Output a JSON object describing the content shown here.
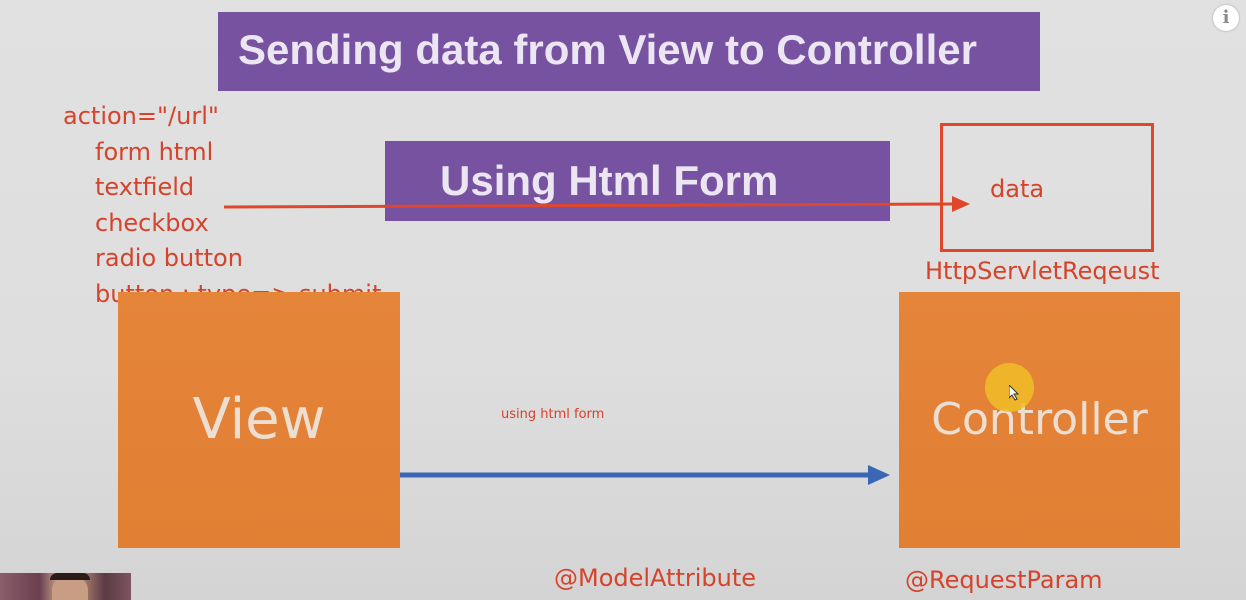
{
  "title": "Sending data from View to Controller",
  "subtitle": "Using Html Form",
  "form_attributes": [
    "action=\"/url\"",
    "form html",
    "textfield",
    "checkbox",
    "radio button",
    "button : type=> submit"
  ],
  "data_box_label": "data",
  "request_label": "HttpServletReqeust",
  "view_label": "View",
  "controller_label": "Controller",
  "arrow_label": "using html form",
  "model_attribute_label": "@ModelAttribute",
  "request_param_label": "@RequestParam",
  "info_label": "i",
  "colors": {
    "banner": "#7652a1",
    "box_orange": "#e2813a",
    "annotation_red": "#d5432b",
    "arrow_blue": "#3a66b5"
  }
}
